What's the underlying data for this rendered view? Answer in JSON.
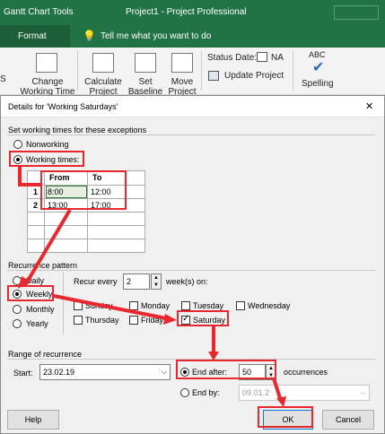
{
  "app": {
    "tools_tab": "Gantt Chart Tools",
    "window_title": "Project1  -  Project Professional",
    "format_tab": "Format",
    "tell_me": "Tell me what you want to do"
  },
  "ribbon": {
    "partial_left": "S",
    "change_working_time": "Change Working Time",
    "calculate_project": "Calculate Project",
    "set_baseline": "Set Baseline",
    "move_project": "Move Project",
    "status_date_label": "Status Date:",
    "status_date_value": "NA",
    "update_project": "Update Project",
    "spelling": "Spelling",
    "abc": "ABC"
  },
  "dialog": {
    "title": "Details for 'Working Saturdays'",
    "close": "✕",
    "section_times": "Set working times for these exceptions",
    "nonworking": "Nonworking",
    "working_times": "Working times:",
    "col_from": "From",
    "col_to": "To",
    "rows": [
      {
        "num": "1",
        "from": "8:00",
        "to": "12:00"
      },
      {
        "num": "2",
        "from": "13:00",
        "to": "17:00"
      }
    ],
    "section_recurrence": "Recurrence pattern",
    "daily": "Daily",
    "weekly": "Weekly",
    "monthly": "Monthly",
    "yearly": "Yearly",
    "recur_every": "Recur every",
    "recur_value": "2",
    "weeks_on": "week(s) on:",
    "days": {
      "sunday": "Sunday",
      "monday": "Monday",
      "tuesday": "Tuesday",
      "wednesday": "Wednesday",
      "thursday": "Thursday",
      "friday": "Friday",
      "saturday": "Saturday"
    },
    "section_range": "Range of recurrence",
    "start_label": "Start:",
    "start_value": "23.02.19",
    "end_after": "End after:",
    "end_after_value": "50",
    "occurrences": "occurrences",
    "end_by": "End by:",
    "end_by_value": "09.01.2",
    "help": "Help",
    "ok": "OK",
    "cancel": "Cancel"
  },
  "colors": {
    "ribbon_green": "#217346",
    "highlight_red": "#e8282e"
  }
}
